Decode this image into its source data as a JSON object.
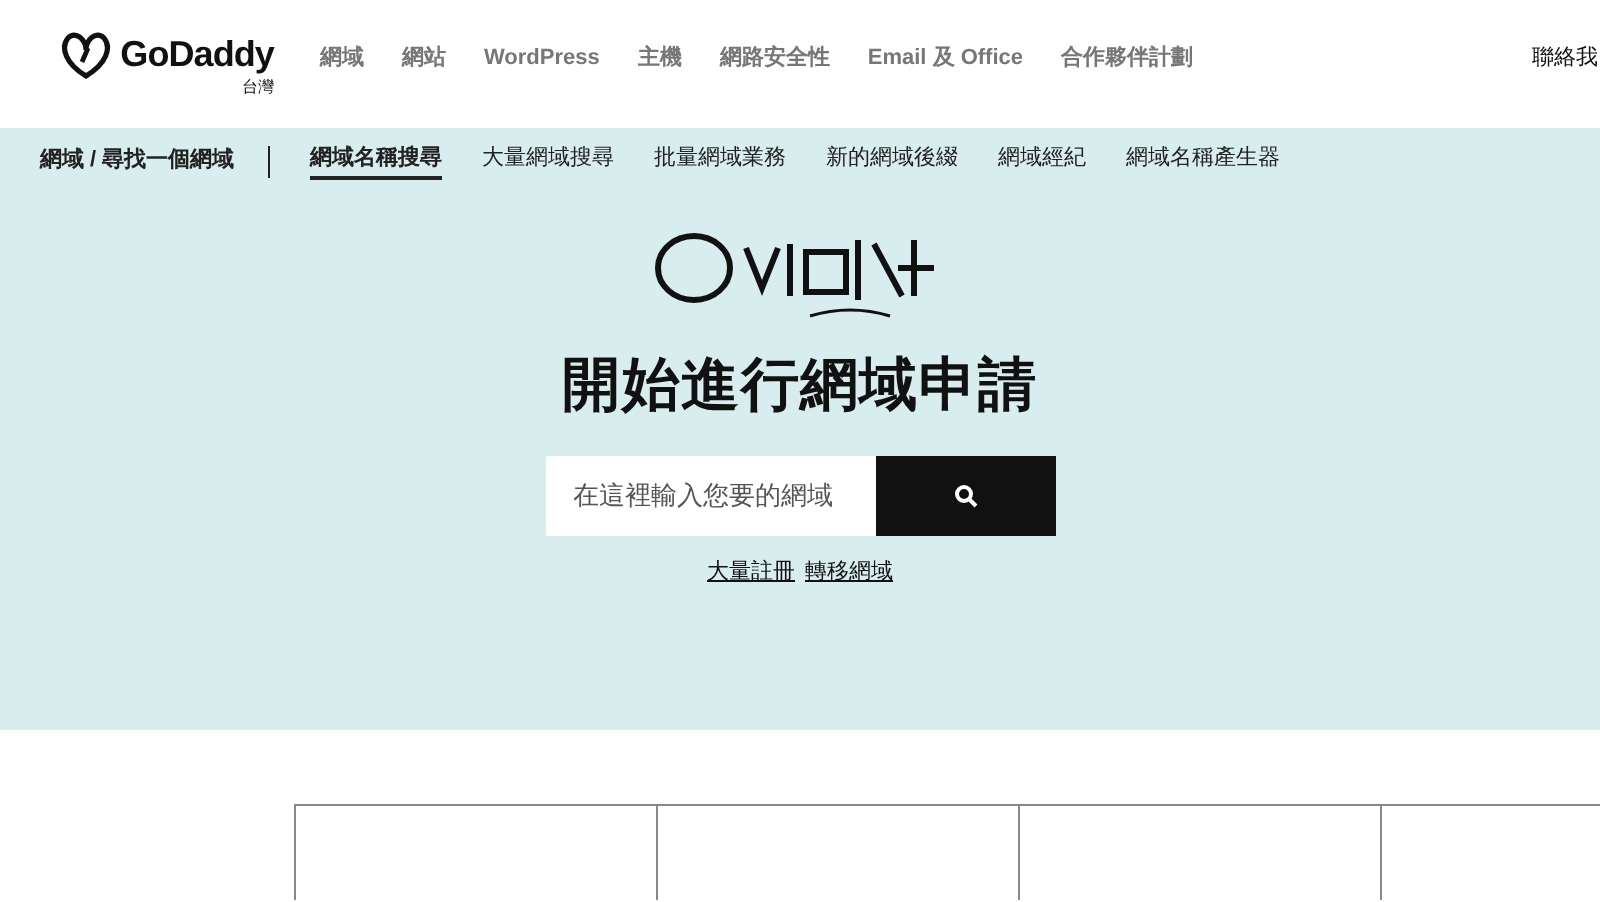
{
  "header": {
    "brand": "GoDaddy",
    "region": "台灣",
    "nav": [
      "網域",
      "網站",
      "WordPress",
      "主機",
      "網路安全性",
      "Email 及 Office",
      "合作夥伴計劃"
    ],
    "contact": "聯絡我"
  },
  "subnav": {
    "breadcrumb": "網域 / 尋找一個網域",
    "items": [
      {
        "label": "網域名稱搜尋",
        "selected": true
      },
      {
        "label": "大量網域搜尋",
        "selected": false
      },
      {
        "label": "批量網域業務",
        "selected": false
      },
      {
        "label": "新的網域後綴",
        "selected": false
      },
      {
        "label": "網域經紀",
        "selected": false
      },
      {
        "label": "網域名稱產生器",
        "selected": false
      }
    ]
  },
  "hero": {
    "title": "開始進行網域申請",
    "search": {
      "placeholder": "在這裡輸入您要的網域"
    },
    "links": [
      "大量註冊",
      "轉移網域"
    ]
  }
}
